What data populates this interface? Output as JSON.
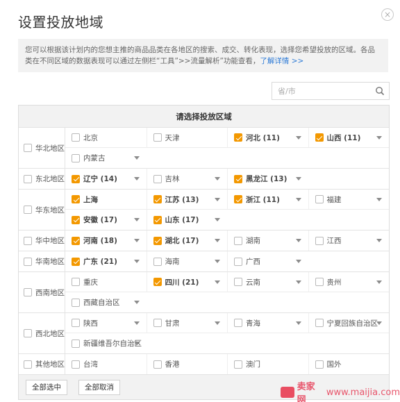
{
  "dialog": {
    "title": "设置投放地域",
    "close_label": "×",
    "notice_text": "您可以根据该计划内的您想主推的商品品类在各地区的搜索、成交、转化表现，选择您希望投放的区域。各品类在不同区域的数据表现可以通过左侧栏“工具”>>流量解析”功能查看，",
    "notice_link": "了解详情 >>"
  },
  "search": {
    "placeholder": "省/市",
    "value": "",
    "icon": "search-icon"
  },
  "grid": {
    "header": "请选择投放区域",
    "regions": [
      {
        "name": "华北地区",
        "checked": false,
        "rows": [
          [
            {
              "name": "北京",
              "checked": false,
              "arrow": false
            },
            {
              "name": "天津",
              "checked": false,
              "arrow": false
            },
            {
              "name": "河北 (11)",
              "checked": true,
              "arrow": true
            },
            {
              "name": "山西 (11)",
              "checked": true,
              "arrow": true
            }
          ],
          [
            {
              "name": "内蒙古",
              "checked": false,
              "arrow": true
            }
          ]
        ]
      },
      {
        "name": "东北地区",
        "checked": false,
        "rows": [
          [
            {
              "name": "辽宁 (14)",
              "checked": true,
              "arrow": true
            },
            {
              "name": "吉林",
              "checked": false,
              "arrow": true
            },
            {
              "name": "黑龙江 (13)",
              "checked": true,
              "arrow": true
            }
          ]
        ]
      },
      {
        "name": "华东地区",
        "checked": false,
        "rows": [
          [
            {
              "name": "上海",
              "checked": true,
              "arrow": false
            },
            {
              "name": "江苏 (13)",
              "checked": true,
              "arrow": true
            },
            {
              "name": "浙江 (11)",
              "checked": true,
              "arrow": true
            },
            {
              "name": "福建",
              "checked": false,
              "arrow": true
            }
          ],
          [
            {
              "name": "安徽 (17)",
              "checked": true,
              "arrow": true
            },
            {
              "name": "山东 (17)",
              "checked": true,
              "arrow": true
            }
          ]
        ]
      },
      {
        "name": "华中地区",
        "checked": false,
        "rows": [
          [
            {
              "name": "河南 (18)",
              "checked": true,
              "arrow": true
            },
            {
              "name": "湖北 (17)",
              "checked": true,
              "arrow": true
            },
            {
              "name": "湖南",
              "checked": false,
              "arrow": true
            },
            {
              "name": "江西",
              "checked": false,
              "arrow": true
            }
          ]
        ]
      },
      {
        "name": "华南地区",
        "checked": false,
        "rows": [
          [
            {
              "name": "广东 (21)",
              "checked": true,
              "arrow": true
            },
            {
              "name": "海南",
              "checked": false,
              "arrow": true
            },
            {
              "name": "广西",
              "checked": false,
              "arrow": true
            }
          ]
        ]
      },
      {
        "name": "西南地区",
        "checked": false,
        "rows": [
          [
            {
              "name": "重庆",
              "checked": false,
              "arrow": false
            },
            {
              "name": "四川 (21)",
              "checked": true,
              "arrow": true
            },
            {
              "name": "云南",
              "checked": false,
              "arrow": true
            },
            {
              "name": "贵州",
              "checked": false,
              "arrow": true
            }
          ],
          [
            {
              "name": "西藏自治区",
              "checked": false,
              "arrow": true
            }
          ]
        ]
      },
      {
        "name": "西北地区",
        "checked": false,
        "rows": [
          [
            {
              "name": "陕西",
              "checked": false,
              "arrow": true
            },
            {
              "name": "甘肃",
              "checked": false,
              "arrow": true
            },
            {
              "name": "青海",
              "checked": false,
              "arrow": true
            },
            {
              "name": "宁夏回族自治区",
              "checked": false,
              "arrow": true
            }
          ],
          [
            {
              "name": "新疆维吾尔自治区",
              "checked": false,
              "arrow": true
            }
          ]
        ]
      },
      {
        "name": "其他地区",
        "checked": false,
        "rows": [
          [
            {
              "name": "台湾",
              "checked": false,
              "arrow": false
            },
            {
              "name": "香港",
              "checked": false,
              "arrow": false
            },
            {
              "name": "澳门",
              "checked": false,
              "arrow": false
            },
            {
              "name": "国外",
              "checked": false,
              "arrow": false
            }
          ]
        ]
      }
    ]
  },
  "footer": {
    "select_all": "全部选中",
    "deselect_all": "全部取消"
  },
  "watermark": {
    "brand": "卖家网",
    "url": "www.maijia.com"
  },
  "colors": {
    "accent": "#f39800",
    "link": "#2e7bd6"
  }
}
